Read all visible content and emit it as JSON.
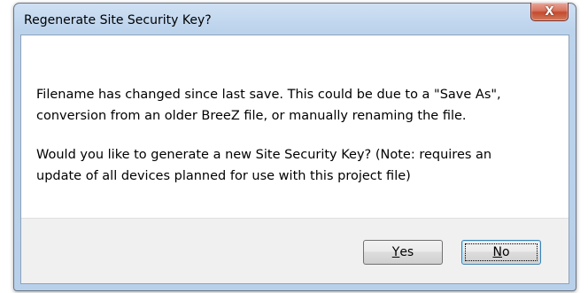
{
  "window": {
    "title": "Regenerate Site Security Key?",
    "close_glyph": "X"
  },
  "message": {
    "paragraph_1": "Filename has changed since last save.  This could be due to a \"Save As\",\nconversion from an older BreeZ file, or manually renaming the file.",
    "paragraph_2": "Would you like to generate a new Site Security Key?  (Note: requires an\nupdate of all devices planned for use with this project file)"
  },
  "buttons": {
    "yes": {
      "accel": "Y",
      "rest": "es"
    },
    "no": {
      "accel": "N",
      "rest": "o"
    }
  },
  "colors": {
    "title_bar": "#bcd3ec",
    "close_button": "#c44a2e",
    "button_panel": "#f0f0f0",
    "default_button_border": "#3c7fb1"
  }
}
